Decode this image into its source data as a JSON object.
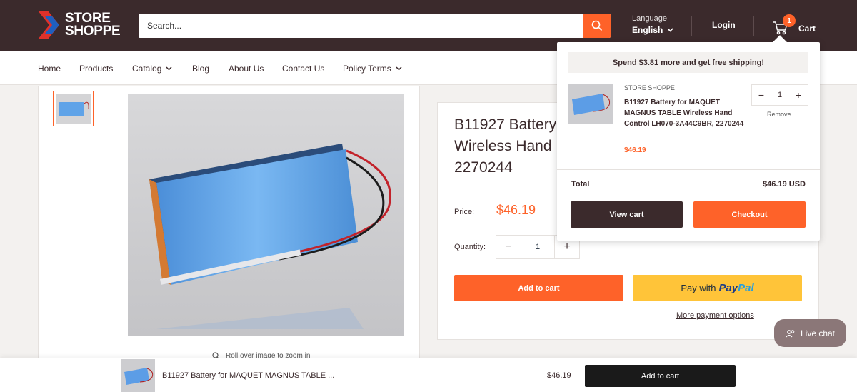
{
  "header": {
    "logo_line1": "STORE",
    "logo_line2": "SHOPPE",
    "search_placeholder": "Search...",
    "language_label": "Language",
    "language_value": "English",
    "login_label": "Login",
    "cart_count": "1",
    "cart_label": "Cart"
  },
  "nav": {
    "items": [
      {
        "label": "Home"
      },
      {
        "label": "Products"
      },
      {
        "label": "Catalog"
      },
      {
        "label": "Blog"
      },
      {
        "label": "About Us"
      },
      {
        "label": "Contact Us"
      },
      {
        "label": "Policy Terms"
      }
    ]
  },
  "product": {
    "zoom_hint": "Roll over image to zoom in",
    "title": "B11927 Battery for MAQUET MAGNUS TABLE Wireless Hand Control LH070-3A44C9BR, 2270244",
    "title_visible": "B11927 Battery\nWireless Hand\n2270244",
    "price_label": "Price:",
    "price": "$46.19",
    "quantity_label": "Quantity:",
    "quantity": "1",
    "add_to_cart": "Add to cart",
    "paypal_prefix": "Pay with",
    "paypal_brand1": "Pay",
    "paypal_brand2": "Pal",
    "more_payment": "More payment options"
  },
  "cart_popup": {
    "shipping_message": "Spend $3.81 more and get free shipping!",
    "item": {
      "vendor": "STORE SHOPPE",
      "title": "B11927 Battery for MAQUET MAGNUS TABLE Wireless Hand Control LH070-3A44C9BR, 2270244",
      "price": "$46.19",
      "quantity": "1",
      "remove": "Remove"
    },
    "total_label": "Total",
    "total_value": "$46.19 USD",
    "view_cart": "View cart",
    "checkout": "Checkout"
  },
  "live_chat": {
    "label": "Live chat"
  },
  "sticky_bar": {
    "title": "B11927 Battery for MAQUET MAGNUS TABLE ...",
    "price": "$46.19",
    "add_to_cart": "Add to cart"
  },
  "colors": {
    "header_bg": "#3b2a2c",
    "accent": "#fe6229",
    "paypal_yellow": "#ffc439"
  }
}
